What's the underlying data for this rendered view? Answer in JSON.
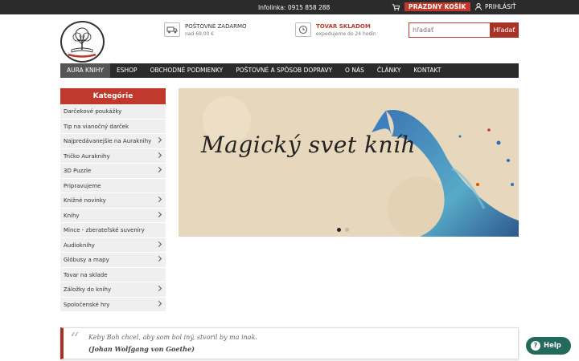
{
  "topbar": {
    "infolinka": "Infolinka: 0915 858 288",
    "cart_label": "PRÁZDNY KOŠÍK",
    "login_label": "PRIHLÁSIŤ"
  },
  "header": {
    "logo_text": "Aura Knihy",
    "shipping_title": "POŠTOVNÉ ZADARMO",
    "shipping_sub": "nad 69,00 €",
    "stock_title": "TOVAR SKLADOM",
    "stock_sub": "expedujeme do 24 hodín",
    "search_placeholder": "hľadať",
    "search_button": "Hľadať"
  },
  "nav": {
    "items": [
      "AURA KNIHY",
      "ESHOP",
      "OBCHODNÉ PODMIENKY",
      "POŠTOVNÉ A SPÔSOB DOPRAVY",
      "O NÁS",
      "ČLÁNKY",
      "KONTAKT"
    ]
  },
  "sidebar": {
    "heading": "Kategórie",
    "items": [
      {
        "label": "Darčekové poukážky",
        "has_sub": false
      },
      {
        "label": "Tip na vianočný darček",
        "has_sub": false
      },
      {
        "label": "Najpredávanejšie na Auraknihy",
        "has_sub": true
      },
      {
        "label": "Tričko Auraknihy",
        "has_sub": true
      },
      {
        "label": "3D Puzzle",
        "has_sub": true
      },
      {
        "label": "Pripravujeme",
        "has_sub": false
      },
      {
        "label": "Knižné novinky",
        "has_sub": true
      },
      {
        "label": "Knihy",
        "has_sub": true
      },
      {
        "label": "Mince - zberateľské suveníry",
        "has_sub": false
      },
      {
        "label": "Audioknihy",
        "has_sub": true
      },
      {
        "label": "Glóbusy a mapy",
        "has_sub": true
      },
      {
        "label": "Tovar na sklade",
        "has_sub": false
      },
      {
        "label": "Záložky do knihy",
        "has_sub": true
      },
      {
        "label": "Spoločenské hry",
        "has_sub": true
      }
    ]
  },
  "banner": {
    "title": "Magický svet kníh",
    "slides": 2,
    "active_slide": 1
  },
  "quote": {
    "text": "Keby Boh chcel, aby som bol iný, stvoril by ma inak.",
    "author": "(Johan Wolfgang von Goethe)"
  },
  "help": {
    "label": "Help"
  },
  "colors": {
    "accent_red": "#c0392b",
    "dark_bar": "#2b2b2b",
    "help_green": "#246a5c"
  }
}
